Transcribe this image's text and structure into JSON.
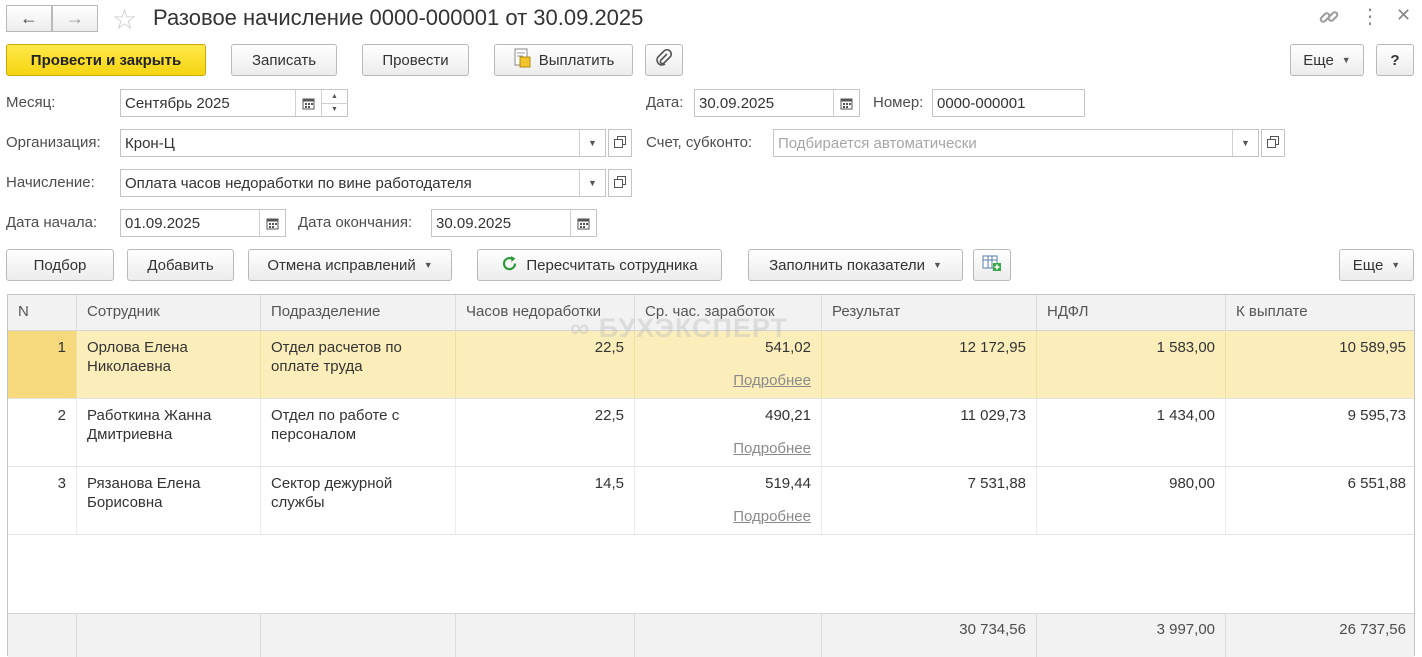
{
  "window": {
    "title": "Разовое начисление 0000-000001 от 30.09.2025"
  },
  "toolbar": {
    "post_close": "Провести и закрыть",
    "save": "Записать",
    "post": "Провести",
    "pay": "Выплатить",
    "more": "Еще",
    "help": "?"
  },
  "form": {
    "month_label": "Месяц:",
    "month_value": "Сентябрь 2025",
    "date_label": "Дата:",
    "date_value": "30.09.2025",
    "number_label": "Номер:",
    "number_value": "0000-000001",
    "org_label": "Организация:",
    "org_value": "Крон-Ц",
    "account_label": "Счет, субконто:",
    "account_placeholder": "Подбирается автоматически",
    "accrual_label": "Начисление:",
    "accrual_value": "Оплата часов недоработки по вине работодателя",
    "start_label": "Дата начала:",
    "start_value": "01.09.2025",
    "end_label": "Дата окончания:",
    "end_value": "30.09.2025"
  },
  "table_toolbar": {
    "pick": "Подбор",
    "add": "Добавить",
    "cancel_corrections": "Отмена исправлений",
    "recalc": "Пересчитать сотрудника",
    "fill_indicators": "Заполнить показатели",
    "more": "Еще"
  },
  "table": {
    "columns": [
      "N",
      "Сотрудник",
      "Подразделение",
      "Часов недоработки",
      "Ср. час. заработок",
      "Результат",
      "НДФЛ",
      "К выплате"
    ],
    "details_link": "Подробнее",
    "rows": [
      {
        "n": "1",
        "employee": "Орлова Елена Николаевна",
        "dept": "Отдел расчетов по оплате труда",
        "hours": "22,5",
        "avg": "541,02",
        "result": "12 172,95",
        "ndfl": "1 583,00",
        "pay": "10 589,95"
      },
      {
        "n": "2",
        "employee": "Работкина Жанна Дмитриевна",
        "dept": "Отдел по работе с персоналом",
        "hours": "22,5",
        "avg": "490,21",
        "result": "11 029,73",
        "ndfl": "1 434,00",
        "pay": "9 595,73"
      },
      {
        "n": "3",
        "employee": "Рязанова Елена Борисовна",
        "dept": "Сектор дежурной службы",
        "hours": "14,5",
        "avg": "519,44",
        "result": "7 531,88",
        "ndfl": "980,00",
        "pay": "6 551,88"
      }
    ],
    "totals": {
      "result": "30 734,56",
      "ndfl": "3 997,00",
      "pay": "26 737,56"
    }
  },
  "watermark": "БУХЭКСПЕРТ"
}
